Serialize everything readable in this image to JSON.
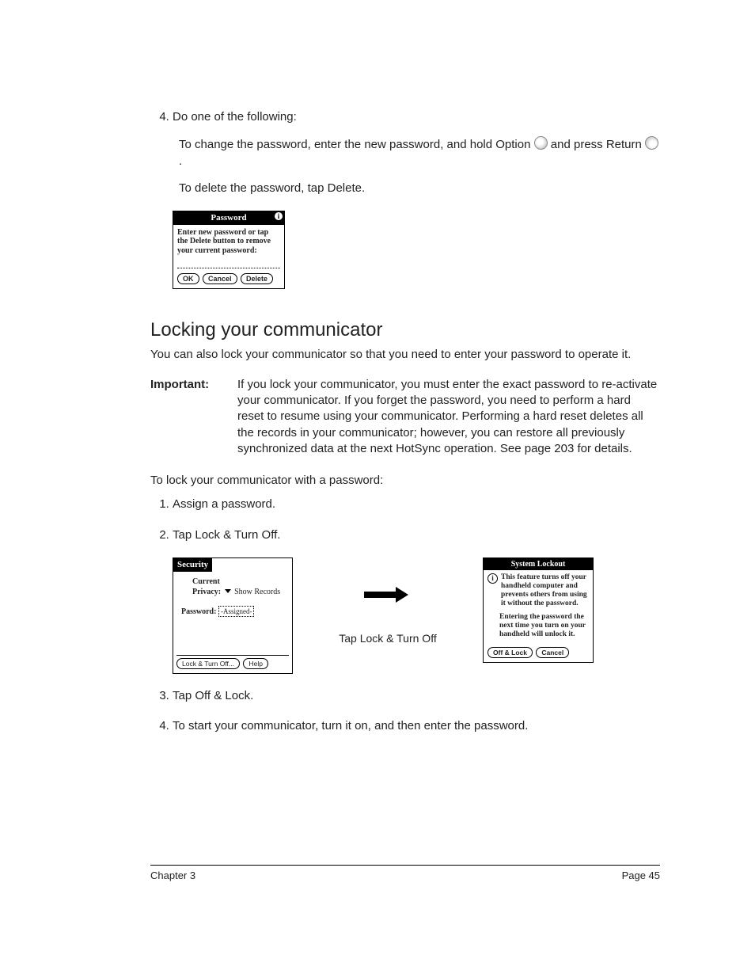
{
  "step4": {
    "num": "4.",
    "lead": "Do one of the following:",
    "change_a": "To change the password, enter the new password, and hold Option ",
    "change_b": " and press Return ",
    "change_c": ".",
    "delete": "To delete the password, tap Delete."
  },
  "pwdlg": {
    "title": "Password",
    "body": "Enter new password or tap the Delete button to remove your current password:",
    "ok": "OK",
    "cancel": "Cancel",
    "del": "Delete"
  },
  "heading": "Locking your communicator",
  "intro": "You can also lock your communicator so that you need to enter your password to operate it.",
  "important_label": "Important:",
  "important_body": "If you lock your communicator, you must enter the exact password to re-activate your communicator. If you forget the password, you need to perform a hard reset to resume using your communicator. Performing a hard reset deletes all the records in your communicator; however, you can restore all previously synchronized data at the next HotSync operation. See page 203 for details.",
  "subhead": "To lock your communicator with a password:",
  "steps": {
    "s1": "Assign a password.",
    "s2": "Tap Lock & Turn Off.",
    "s3": "Tap Off & Lock.",
    "s4": "To start your communicator, turn it on, and then enter the password."
  },
  "security": {
    "tab": "Security",
    "line1a": "Current",
    "line1b": "Privacy:",
    "show": "Show Records",
    "pw_label": "Password:",
    "pw_val": "-Assigned-",
    "lock": "Lock & Turn Off...",
    "help": "Help"
  },
  "caption": "Tap Lock & Turn Off",
  "lockout": {
    "title": "System Lockout",
    "p1": "This feature turns off your handheld computer and prevents others from using it without the password.",
    "p2": "Entering the password the next time you turn on your handheld will unlock it.",
    "off": "Off & Lock",
    "cancel": "Cancel"
  },
  "footer": {
    "left": "Chapter 3",
    "right": "Page 45"
  }
}
